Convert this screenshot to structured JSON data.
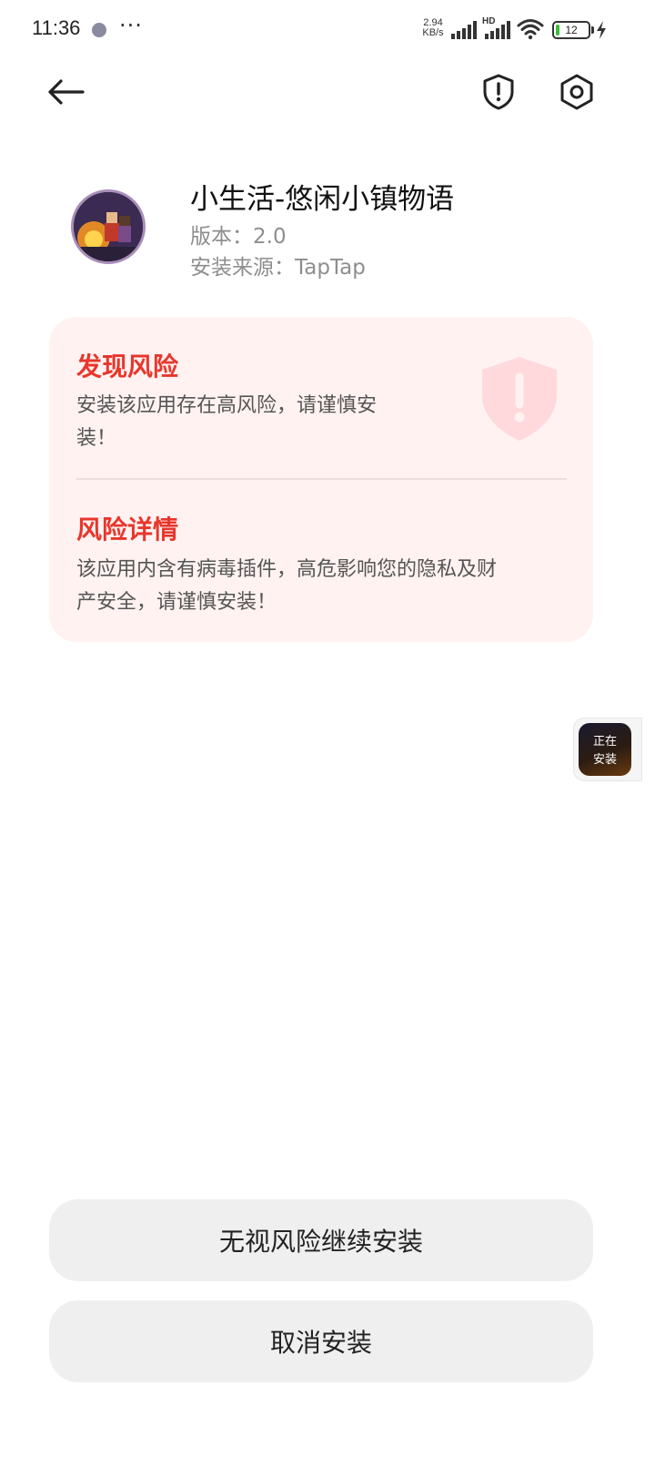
{
  "status_bar": {
    "time": "11:36",
    "more": "···",
    "net_speed_value": "2.94",
    "net_speed_unit": "KB/s",
    "signal_label": "HD",
    "battery": "12",
    "battery_level_percent": 12
  },
  "app": {
    "name": "小生活-悠闲小镇物语",
    "version": "版本：2.0",
    "source": "安装来源：TapTap"
  },
  "risk": {
    "found_title": "发现风险",
    "found_text_line1": "安装该应用存在高风险，请谨慎安",
    "found_text_line2": "装！",
    "detail_title": "风险详情",
    "detail_text_line1": "该应用内含有病毒插件，高危影响您的隐私及财",
    "detail_text_line2": "产安全，请谨慎安装！",
    "accent_color": "#e8362c"
  },
  "floating": {
    "line1": "正在",
    "line2": "安装"
  },
  "buttons": {
    "ignore_risk": "无视风险继续安装",
    "cancel": "取消安装"
  },
  "icons": {
    "back": "arrow-left-icon",
    "shield": "shield-alert-icon",
    "settings": "gear-icon"
  }
}
